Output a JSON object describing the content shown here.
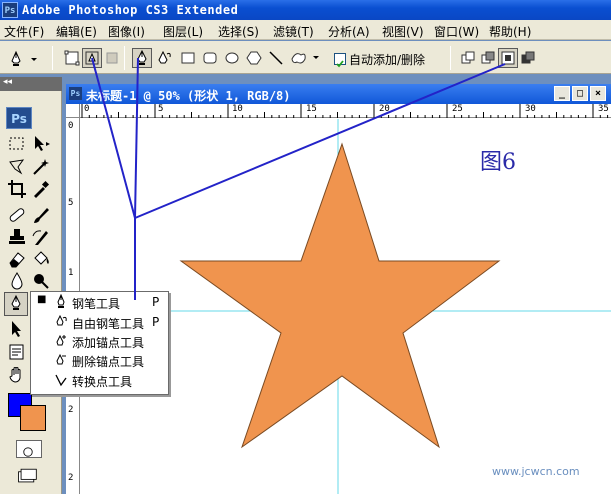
{
  "app": {
    "title": "Adobe Photoshop CS3 Extended",
    "badge": "Ps"
  },
  "menu": [
    "文件(F)",
    "编辑(E)",
    "图像(I)",
    "图层(L)",
    "选择(S)",
    "滤镜(T)",
    "分析(A)",
    "视图(V)",
    "窗口(W)",
    "帮助(H)"
  ],
  "options": {
    "auto_add_delete_label": "自动添加/删除",
    "auto_add_delete_checked": true
  },
  "toolbox": {
    "collapse_glyph": "◂◂",
    "logo": "Ps",
    "foreground_color": "#0000ff",
    "background_color": "#f0944e"
  },
  "document": {
    "title": "未标题-1 @ 50% (形状 1, RGB/8)",
    "ps_mini": "Ps",
    "window_buttons": [
      "_",
      "□",
      "×"
    ],
    "ruler_h": [
      "0",
      "5",
      "10",
      "15",
      "20",
      "25",
      "30",
      "35"
    ],
    "ruler_v": [
      "0",
      "5",
      "1",
      "1",
      "2",
      "2"
    ],
    "star_fill": "#f0944e",
    "guide_color": "#66d9e8"
  },
  "flyout": {
    "items": [
      {
        "label": "钢笔工具",
        "key": "P",
        "active": true
      },
      {
        "label": "自由钢笔工具",
        "key": "P",
        "active": false
      },
      {
        "label": "添加锚点工具",
        "key": "",
        "active": false
      },
      {
        "label": "删除锚点工具",
        "key": "",
        "active": false
      },
      {
        "label": "转换点工具",
        "key": "",
        "active": false
      }
    ],
    "active_bullet": "■"
  },
  "annotation": {
    "figure_label": "图6",
    "line_color": "#2323c8"
  },
  "watermark": "www.jcwcn.com"
}
